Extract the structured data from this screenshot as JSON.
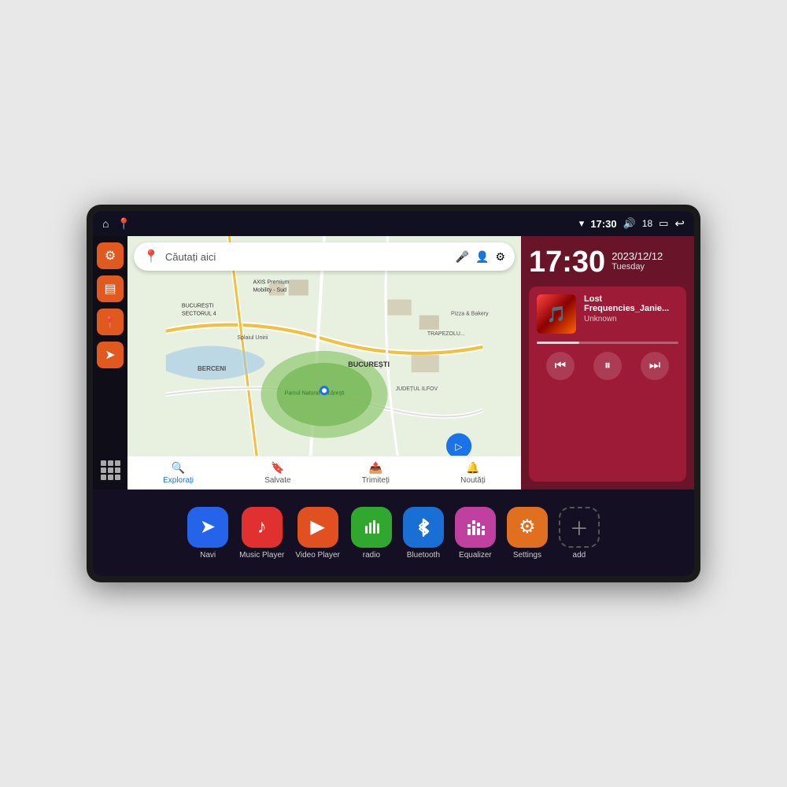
{
  "device": {
    "status_bar": {
      "wifi_icon": "▾",
      "time": "17:30",
      "volume_icon": "🔊",
      "battery_level": "18",
      "battery_icon": "🔋",
      "back_icon": "↩"
    },
    "sidebar": {
      "settings_icon": "⚙",
      "folder_icon": "▤",
      "map_pin_icon": "📍",
      "nav_arrow_icon": "➤"
    },
    "map": {
      "search_placeholder": "Căutați aici",
      "pin_icon": "📍",
      "mic_icon": "🎤",
      "account_icon": "👤",
      "settings_icon": "⚙",
      "bottom_nav": [
        {
          "label": "Explorați",
          "icon": "🔍",
          "active": true
        },
        {
          "label": "Salvate",
          "icon": "🔖",
          "active": false
        },
        {
          "label": "Trimiteți",
          "icon": "📤",
          "active": false
        },
        {
          "label": "Noutăți",
          "icon": "🔔",
          "active": false
        }
      ]
    },
    "clock": {
      "time": "17:30",
      "date_year": "2023/12/12",
      "day": "Tuesday"
    },
    "music": {
      "title": "Lost Frequencies_Janie...",
      "artist": "Unknown",
      "prev_icon": "⏮",
      "pause_icon": "⏸",
      "next_icon": "⏭"
    },
    "dock": {
      "apps": [
        {
          "key": "navi",
          "label": "Navi",
          "icon": "➤",
          "bg": "app-navi"
        },
        {
          "key": "music",
          "label": "Music Player",
          "icon": "♪",
          "bg": "app-music"
        },
        {
          "key": "video",
          "label": "Video Player",
          "icon": "▶",
          "bg": "app-video"
        },
        {
          "key": "radio",
          "label": "radio",
          "icon": "📻",
          "bg": "app-radio"
        },
        {
          "key": "bluetooth",
          "label": "Bluetooth",
          "icon": "⚡",
          "bg": "app-bluetooth"
        },
        {
          "key": "equalizer",
          "label": "Equalizer",
          "icon": "🎚",
          "bg": "app-equalizer"
        },
        {
          "key": "settings",
          "label": "Settings",
          "icon": "⚙",
          "bg": "app-settings"
        },
        {
          "key": "add",
          "label": "add",
          "icon": "+",
          "bg": "app-add"
        }
      ]
    }
  }
}
